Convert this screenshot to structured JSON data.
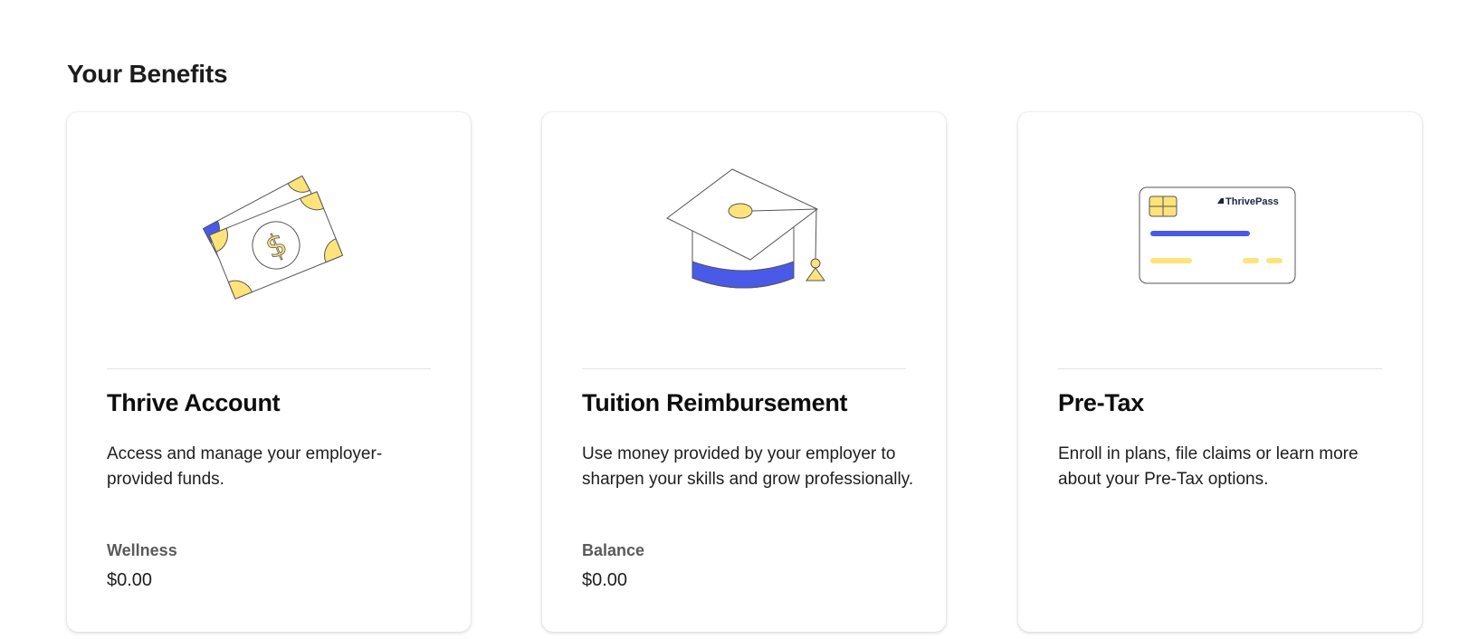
{
  "section": {
    "title": "Your Benefits"
  },
  "colors": {
    "accent_blue": "#4a5ae8",
    "accent_yellow": "#fde37a",
    "marker_red": "#e24a3b"
  },
  "cards": [
    {
      "title": "Thrive Account",
      "description": "Access and manage your employer-provided funds.",
      "label": "Wellness",
      "value": "$0.00",
      "icon": "money-bills-icon"
    },
    {
      "title": "Tuition Reimbursement",
      "description": "Use money provided by your employer to sharpen your skills and grow professionally.",
      "label": "Balance",
      "value": "$0.00",
      "icon": "graduation-cap-icon"
    },
    {
      "title": "Pre-Tax",
      "description": "Enroll in plans, file claims or learn more about your Pre-Tax options.",
      "icon": "payment-card-icon",
      "card_brand": "ThrivePass"
    }
  ]
}
